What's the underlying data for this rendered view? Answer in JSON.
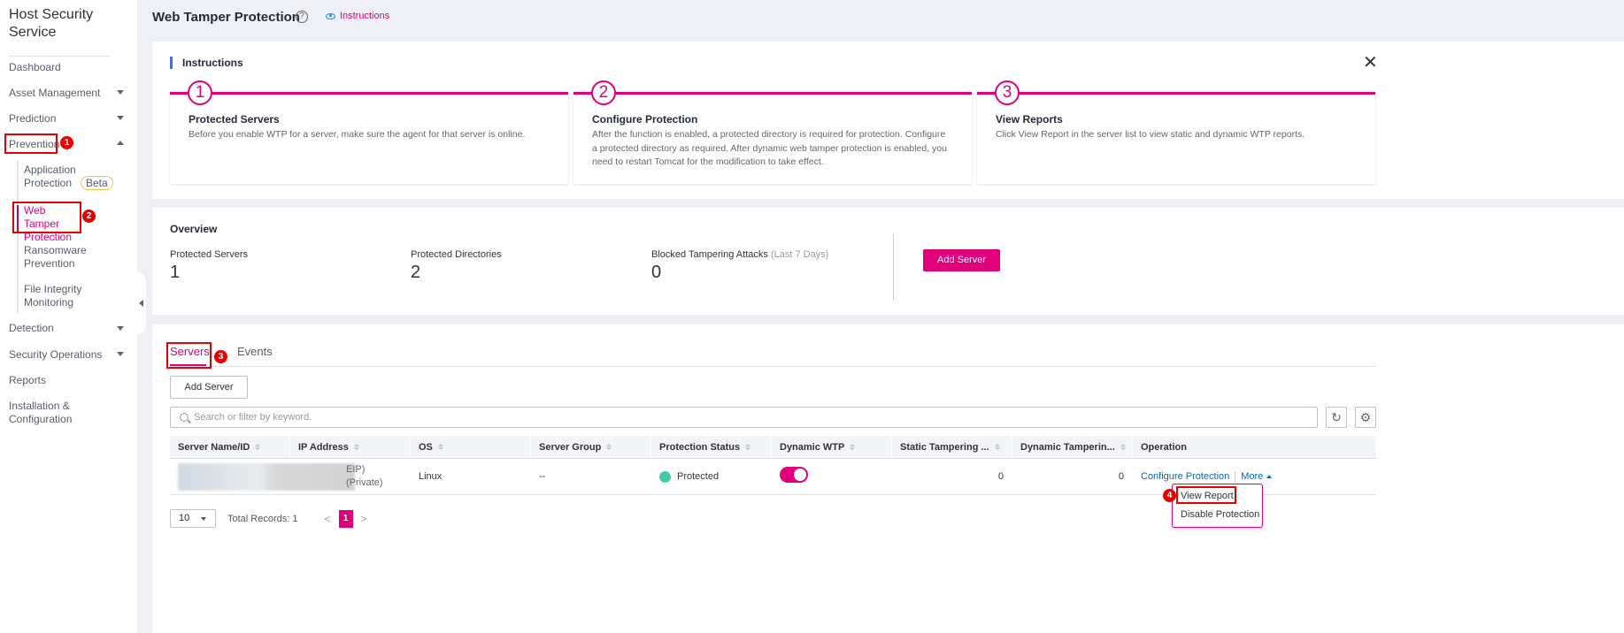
{
  "sidebar": {
    "brand": "Host Security Service",
    "items": [
      {
        "label": "Dashboard"
      },
      {
        "label": "Asset Management"
      },
      {
        "label": "Prediction"
      },
      {
        "label": "Prevention"
      },
      {
        "label": "Detection"
      },
      {
        "label": "Security Operations"
      },
      {
        "label": "Reports"
      },
      {
        "label": "Installation & Configuration"
      }
    ],
    "prevention_sub": [
      {
        "label": "Application Protection",
        "badge": "Beta"
      },
      {
        "label": "Web Tamper Protection"
      },
      {
        "label": "Ransomware Prevention"
      },
      {
        "label": "File Integrity Monitoring"
      }
    ]
  },
  "annotations": [
    "1",
    "2",
    "3",
    "4"
  ],
  "header": {
    "title": "Web Tamper Protection",
    "help": "?",
    "instructions_link": "Instructions"
  },
  "instructions": {
    "heading": "Instructions",
    "close": "✕",
    "steps": [
      {
        "number": "1",
        "title": "Protected Servers",
        "desc": "Before you enable WTP for a server, make sure the agent for that server is online."
      },
      {
        "number": "2",
        "title": "Configure Protection",
        "desc": "After the function is enabled, a protected directory is required for protection. Configure a protected directory as required. After dynamic web tamper protection is enabled, you need to restart Tomcat for the modification to take effect."
      },
      {
        "number": "3",
        "title": "View Reports",
        "desc": "Click View Report in the server list to view static and dynamic WTP reports."
      }
    ]
  },
  "overview": {
    "title": "Overview",
    "stats": [
      {
        "label": "Protected Servers",
        "sub": "",
        "value": "1"
      },
      {
        "label": "Protected Directories",
        "sub": "",
        "value": "2"
      },
      {
        "label": "Blocked Tampering Attacks",
        "sub": "(Last 7 Days)",
        "value": "0"
      }
    ],
    "add_server": "Add Server"
  },
  "servers": {
    "tabs": [
      {
        "label": "Servers"
      },
      {
        "label": "Events"
      }
    ],
    "add_server": "Add Server",
    "search_placeholder": "Search or filter by keyword.",
    "refresh_icon": "↻",
    "settings_icon": "⚙",
    "columns": [
      "Server Name/ID",
      "IP Address",
      "OS",
      "Server Group",
      "Protection Status",
      "Dynamic WTP",
      "Static Tampering ...",
      "Dynamic Tamperin...",
      "Operation"
    ],
    "rows": [
      {
        "ip_eip": "EIP)",
        "ip_private": "(Private)",
        "os": "Linux",
        "group": "--",
        "status": "Protected",
        "status_color": "#3dcca6",
        "dynamic_wtp": true,
        "static_count": "0",
        "dynamic_count": "0",
        "op_configure": "Configure Protection",
        "op_more": "More"
      }
    ],
    "more_menu": [
      "View Report",
      "Disable Protection"
    ],
    "pagination": {
      "page_size": "10",
      "total": "Total Records: 1",
      "current_page": "1",
      "prev": "<",
      "next": ">"
    }
  },
  "colors": {
    "accent": "#e0007a",
    "link": "#0a66b8",
    "annotation": "#e60000"
  }
}
